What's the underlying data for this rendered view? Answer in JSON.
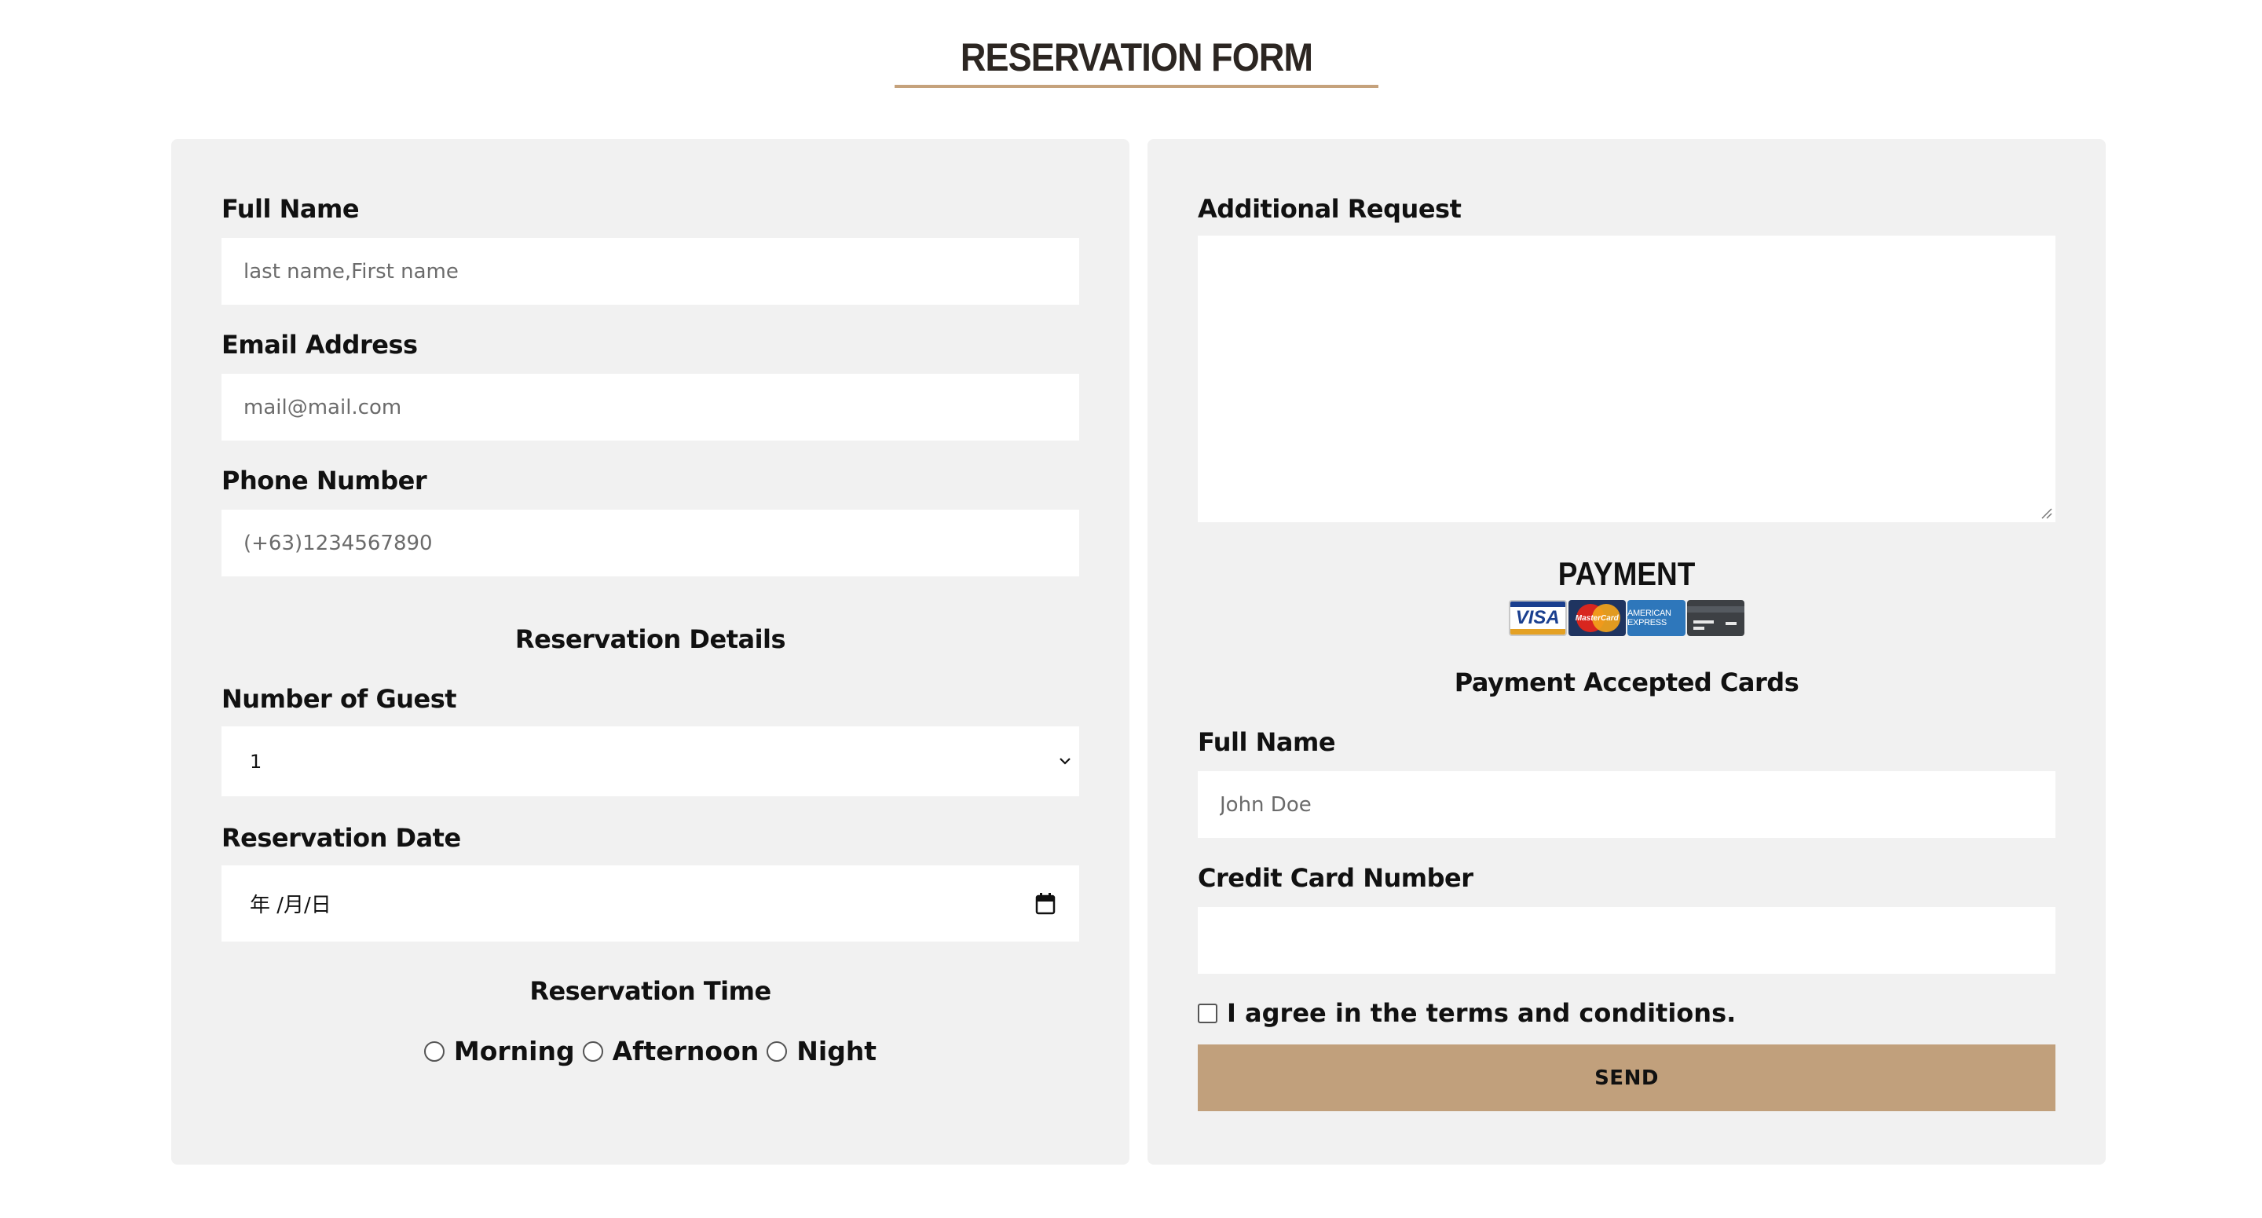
{
  "header": {
    "title": "RESERVATION FORM"
  },
  "left_panel": {
    "full_name": {
      "label": "Full Name",
      "placeholder": "last name,First name"
    },
    "email": {
      "label": "Email Address",
      "placeholder": "mail@mail.com"
    },
    "phone": {
      "label": "Phone Number",
      "placeholder": "(+63)1234567890"
    },
    "reservation_details_heading": "Reservation Details",
    "guests": {
      "label": "Number of Guest",
      "value": "1"
    },
    "date": {
      "label": "Reservation Date",
      "value": "年 /月/日"
    },
    "time": {
      "heading": "Reservation Time",
      "options": [
        "Morning",
        "Afternoon",
        "Night"
      ]
    }
  },
  "right_panel": {
    "additional_request": {
      "label": "Additional Request"
    },
    "payment": {
      "title": "PAYMENT",
      "cards": [
        "VISA",
        "MasterCard",
        "AMERICAN EXPRESS",
        "generic-card-icon"
      ],
      "accepted_label": "Payment Accepted Cards"
    },
    "card_name": {
      "label": "Full Name",
      "placeholder": "John Doe"
    },
    "card_number": {
      "label": "Credit Card Number",
      "placeholder": ""
    },
    "terms_label": "I agree in the terms and conditions.",
    "send_label": "SEND"
  },
  "colors": {
    "accent": "#c1a07c",
    "panel_bg": "#f1f1f1",
    "title_text": "#2c2622"
  }
}
